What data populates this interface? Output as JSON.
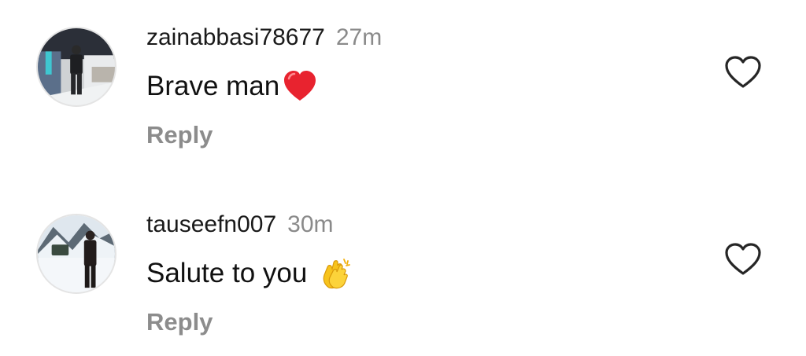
{
  "comments": [
    {
      "username": "zainabbasi78677",
      "time": "27m",
      "text": "Brave man",
      "emoji": "red-heart",
      "reply_label": "Reply",
      "liked": false,
      "avatar": "avatar-man-night-snow"
    },
    {
      "username": "tauseefn007",
      "time": "30m",
      "text": "Salute to you",
      "emoji": "clapping-hands",
      "reply_label": "Reply",
      "liked": false,
      "avatar": "avatar-man-snowy-mountains"
    }
  ],
  "colors": {
    "username": "#1a1a1a",
    "time": "#8a8a8a",
    "reply": "#8c8c8c",
    "heart_outline": "#262626",
    "emoji_heart": "#e8232f",
    "emoji_clap": "#f7c31c"
  }
}
